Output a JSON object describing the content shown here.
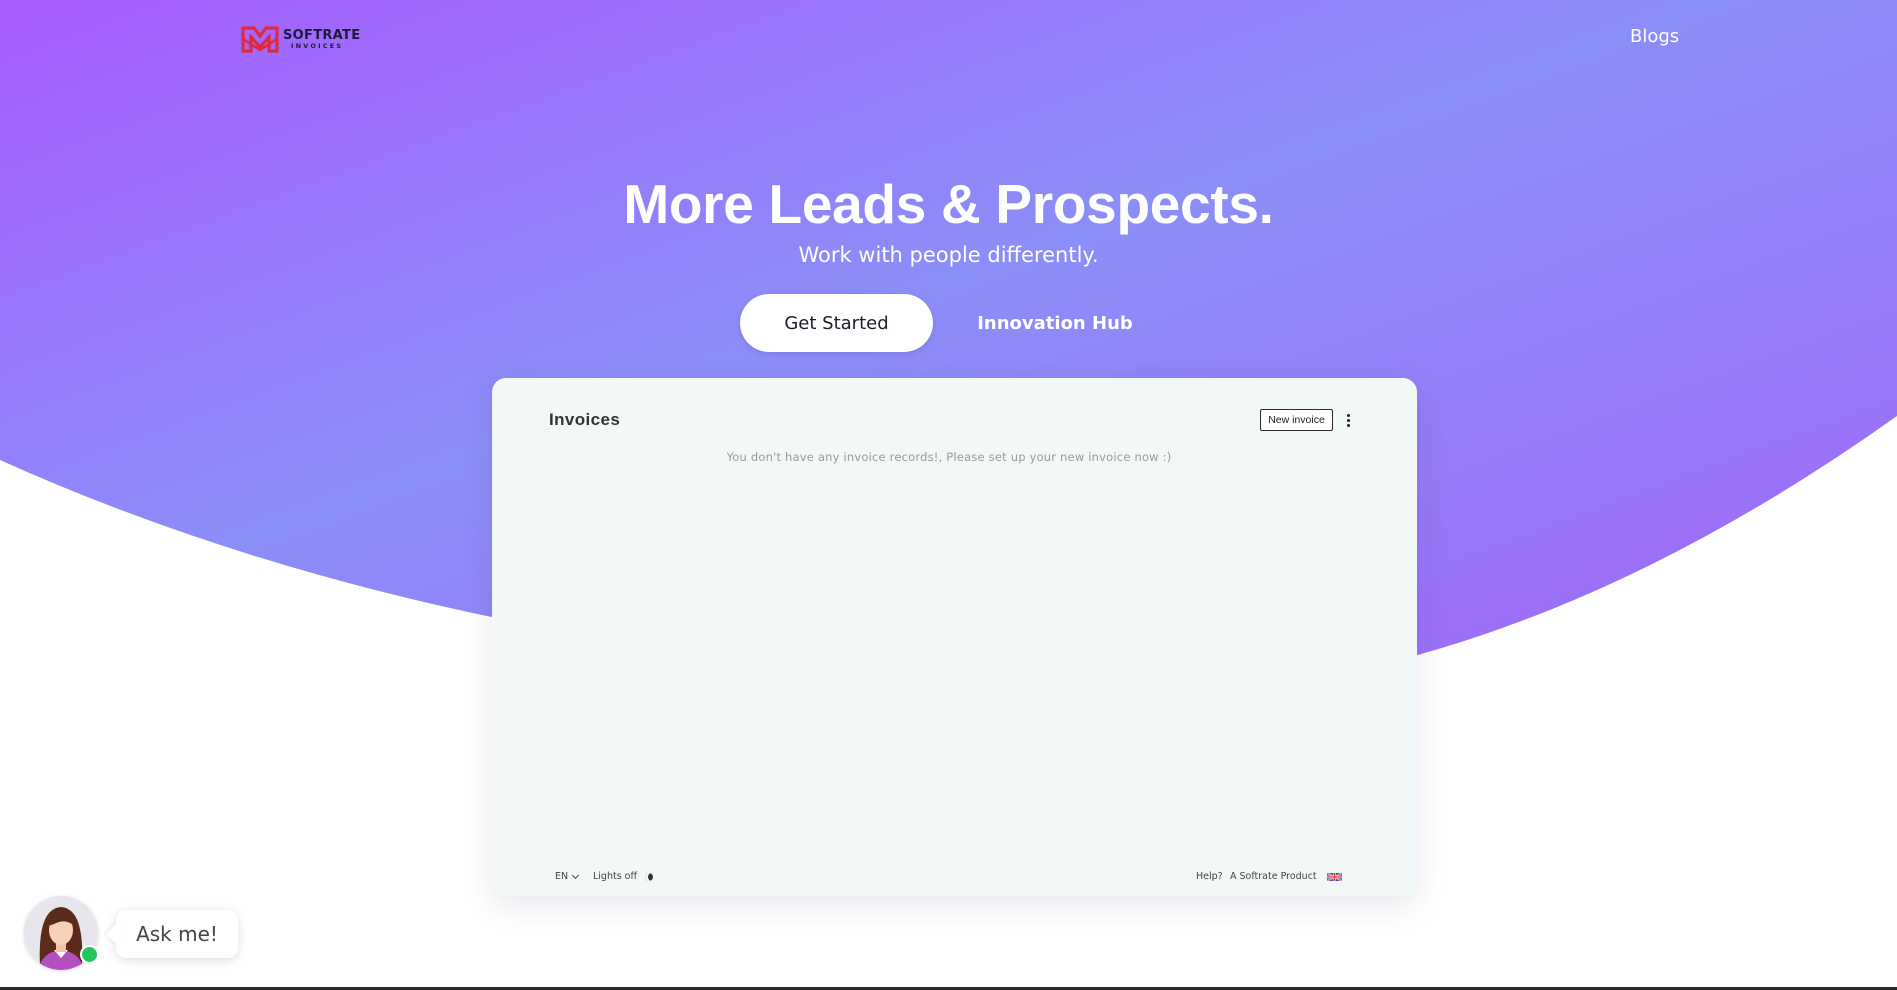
{
  "brand": {
    "name_line1": "SOFTRATE",
    "name_line2": "INVOICES",
    "logo_color": "#e02a3a"
  },
  "nav": {
    "blogs_label": "Blogs"
  },
  "hero": {
    "title": "More Leads & Prospects.",
    "subtitle": "Work with people differently.",
    "primary_button": "Get Started",
    "secondary_button": "Innovation Hub",
    "gradient_colors": [
      "#a75cff",
      "#8b8ef8",
      "#a265f7"
    ]
  },
  "invoices_card": {
    "title": "Invoices",
    "new_invoice_button": "New invoice",
    "menu_icon": "kebab-menu-icon",
    "empty_message": "You don't have any invoice records!, Please set up your new invoice now :)",
    "footer": {
      "language": "EN",
      "lights_label": "Lights off",
      "help_label": "Help?",
      "product_label": "A Softrate Product",
      "flag_icon": "uk-flag-icon",
      "theme_icon": "moon-icon"
    }
  },
  "chat_widget": {
    "bubble_text": "Ask me!",
    "status_color": "#22c55e"
  }
}
